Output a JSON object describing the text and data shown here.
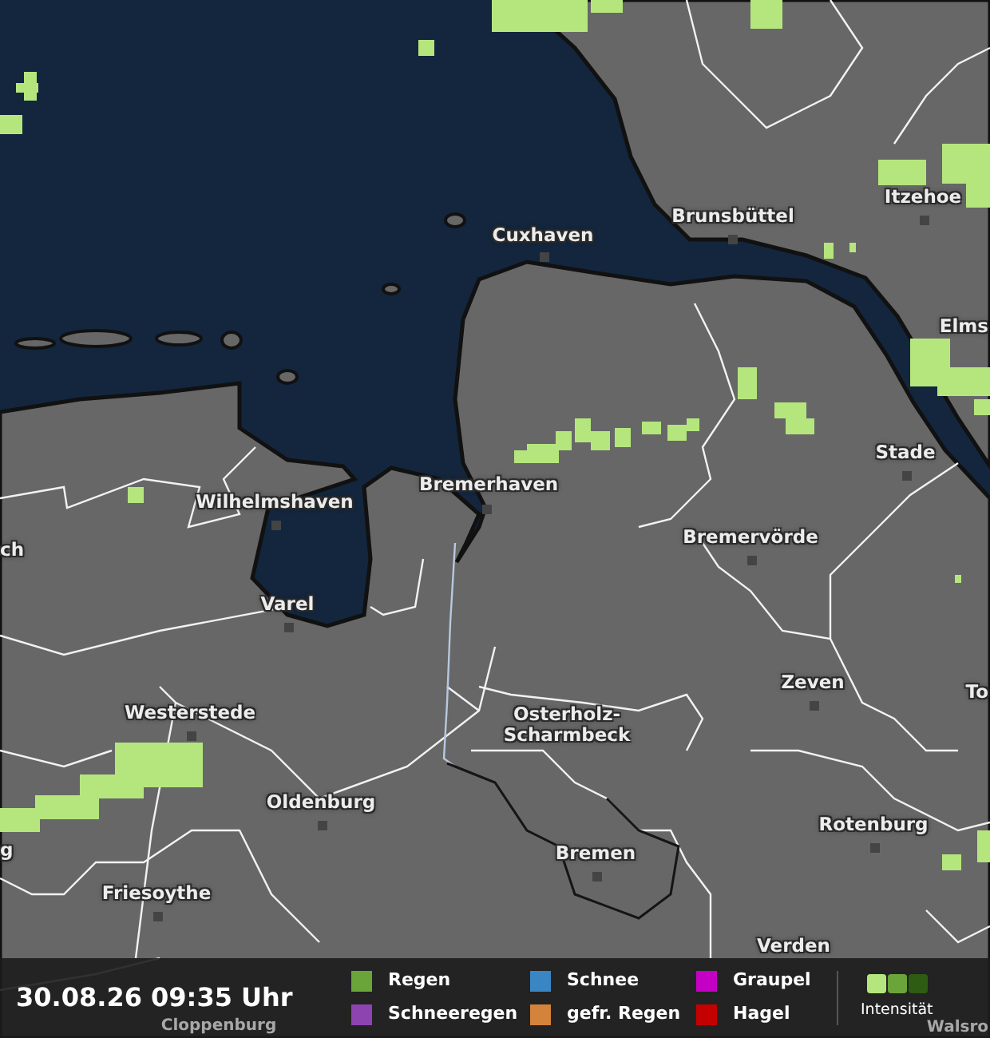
{
  "map": {
    "cities": [
      {
        "name": "Cuxhaven"
      },
      {
        "name": "Brunsbüttel"
      },
      {
        "name": "Itzehoe"
      },
      {
        "name": "Elms"
      },
      {
        "name": "Stade"
      },
      {
        "name": "Bremerhaven"
      },
      {
        "name": "Wilhelmshaven"
      },
      {
        "name": "ch"
      },
      {
        "name": "Bremervörde"
      },
      {
        "name": "Varel"
      },
      {
        "name": "Zeven"
      },
      {
        "name": "To"
      },
      {
        "name": "Westerstede"
      },
      {
        "name": "Osterholz-Scharmbeck"
      },
      {
        "name": "Oldenburg"
      },
      {
        "name": "Rotenburg"
      },
      {
        "name": "g"
      },
      {
        "name": "Bremen"
      },
      {
        "name": "Friesoythe"
      },
      {
        "name": "Verden"
      },
      {
        "name": "Walsro"
      },
      {
        "name": "Cloppenburg"
      }
    ]
  },
  "legend": {
    "timestamp": "30.08.26 09:35 Uhr",
    "precipitation_types": [
      {
        "label": "Regen",
        "color": "#6aa539"
      },
      {
        "label": "Schneeregen",
        "color": "#8e44b0"
      },
      {
        "label": "Schnee",
        "color": "#3a86c4"
      },
      {
        "label": "gefr. Regen",
        "color": "#d4833a"
      },
      {
        "label": "Graupel",
        "color": "#c400c4"
      },
      {
        "label": "Hagel",
        "color": "#c40000"
      }
    ],
    "intensity": {
      "label": "Intensität",
      "steps": [
        {
          "color": "#b5e67d"
        },
        {
          "color": "#6aa539"
        },
        {
          "color": "#2e5c12"
        }
      ]
    }
  }
}
